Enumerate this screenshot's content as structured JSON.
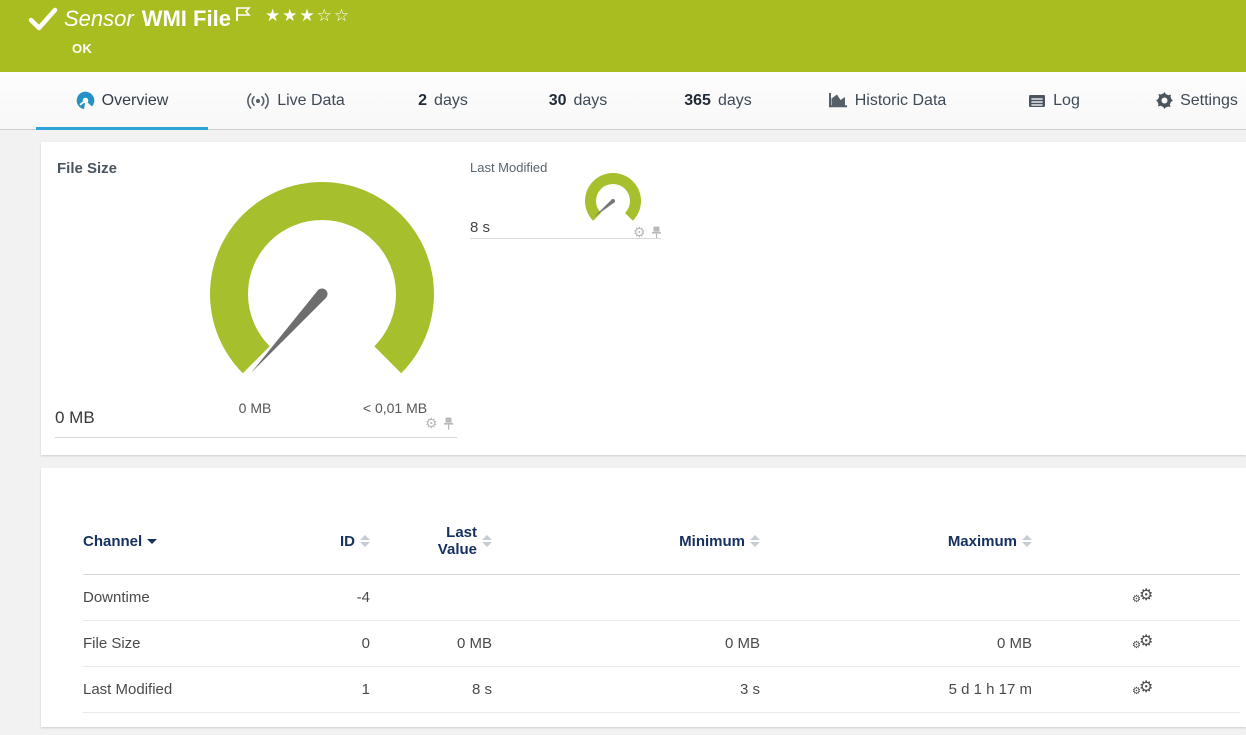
{
  "header": {
    "kind_label": "Sensor",
    "sensor_name": "WMI File",
    "status_text": "OK",
    "rating_filled": 3,
    "rating_total": 5,
    "color": "#a9bd20"
  },
  "tabs": [
    {
      "label": "Overview"
    },
    {
      "label": "Live Data"
    },
    {
      "number": "2",
      "label": "days"
    },
    {
      "number": "30",
      "label": "days"
    },
    {
      "number": "365",
      "label": "days"
    },
    {
      "label": "Historic Data"
    },
    {
      "label": "Log"
    },
    {
      "label": "Settings"
    }
  ],
  "gauges": {
    "primary": {
      "title": "File Size",
      "value": "0 MB",
      "scale_min": "0 MB",
      "scale_max": "< 0,01 MB"
    },
    "secondary": {
      "title": "Last Modified",
      "value": "8 s"
    }
  },
  "table": {
    "headers": {
      "channel": "Channel",
      "id": "ID",
      "last_value": "Last Value",
      "minimum": "Minimum",
      "maximum": "Maximum"
    },
    "rows": [
      {
        "channel": "Downtime",
        "id": "-4",
        "last_value": "",
        "minimum": "",
        "maximum": ""
      },
      {
        "channel": "File Size",
        "id": "0",
        "last_value": "0 MB",
        "minimum": "0 MB",
        "maximum": "0 MB"
      },
      {
        "channel": "Last Modified",
        "id": "1",
        "last_value": "8 s",
        "minimum": "3 s",
        "maximum": "5 d 1 h 17 m"
      }
    ]
  },
  "colors": {
    "header_green": "#a9bd20",
    "gauge_green": "#a6c02d",
    "accent_blue": "#2fa3d6",
    "table_header_text": "#16305f"
  }
}
